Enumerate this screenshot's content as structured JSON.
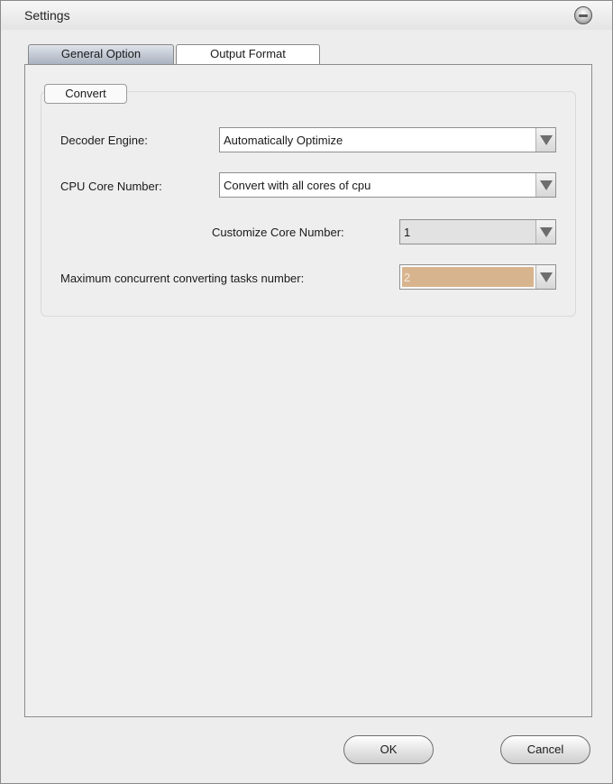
{
  "window": {
    "title": "Settings"
  },
  "tabs": [
    {
      "label": "General Option",
      "active": true
    },
    {
      "label": "Output Format",
      "active": false
    }
  ],
  "group": {
    "title": "Convert",
    "decoder_engine": {
      "label": "Decoder Engine:",
      "value": "Automatically Optimize"
    },
    "cpu_core_number": {
      "label": "CPU Core Number:",
      "value": "Convert with all cores of cpu"
    },
    "customize_core_number": {
      "label": "Customize Core Number:",
      "value": "1"
    },
    "max_concurrent_tasks": {
      "label": "Maximum concurrent converting tasks number:",
      "value": "2"
    }
  },
  "buttons": {
    "ok": "OK",
    "cancel": "Cancel"
  },
  "colors": {
    "highlight": "#d8b48e",
    "active_tab": "#a9b2c0"
  },
  "icons": {
    "close": "close-icon",
    "dropdown": "chevron-down-icon"
  }
}
